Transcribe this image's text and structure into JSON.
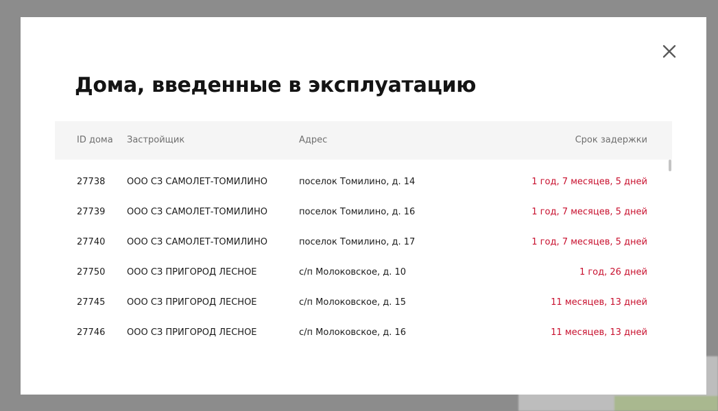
{
  "modal": {
    "title": "Дома, введенные в эксплуатацию",
    "close_icon": "close-icon"
  },
  "table": {
    "headers": {
      "id": "ID дома",
      "developer": "Застройщик",
      "address": "Адрес",
      "delay": "Срок задержки"
    },
    "rows": [
      {
        "id": "27738",
        "developer": "ООО СЗ САМОЛЕТ-ТОМИЛИНО",
        "address": "поселок Томилино, д. 14",
        "delay": "1 год, 7 месяцев, 5 дней"
      },
      {
        "id": "27739",
        "developer": "ООО СЗ САМОЛЕТ-ТОМИЛИНО",
        "address": "поселок Томилино, д. 16",
        "delay": "1 год, 7 месяцев, 5 дней"
      },
      {
        "id": "27740",
        "developer": "ООО СЗ САМОЛЕТ-ТОМИЛИНО",
        "address": "поселок Томилино, д. 17",
        "delay": "1 год, 7 месяцев, 5 дней"
      },
      {
        "id": "27750",
        "developer": "ООО СЗ ПРИГОРОД ЛЕСНОЕ",
        "address": "с/п Молоковское, д. 10",
        "delay": "1 год, 26 дней"
      },
      {
        "id": "27745",
        "developer": "ООО СЗ ПРИГОРОД ЛЕСНОЕ",
        "address": "с/п Молоковское, д. 15",
        "delay": "11 месяцев, 13 дней"
      },
      {
        "id": "27746",
        "developer": "ООО СЗ ПРИГОРОД ЛЕСНОЕ",
        "address": "с/п Молоковское, д. 16",
        "delay": "11 месяцев, 13 дней"
      }
    ]
  },
  "colors": {
    "delay_text": "#c8102e",
    "header_bg": "#f5f5f5",
    "backdrop": "#8c8c8c"
  }
}
